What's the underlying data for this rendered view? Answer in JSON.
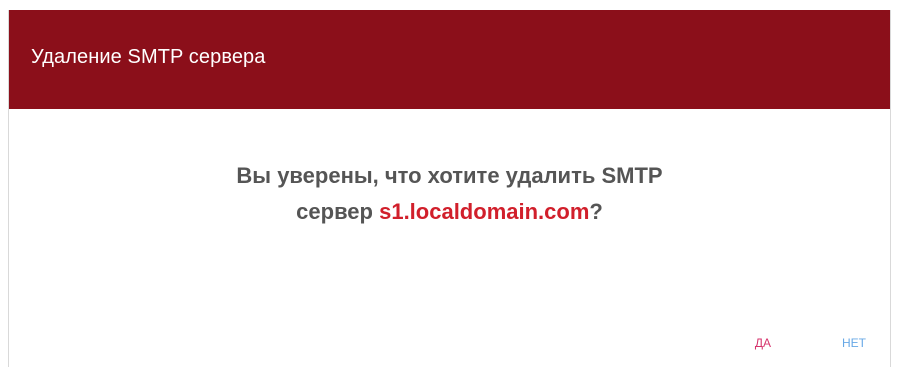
{
  "dialog": {
    "title": "Удаление SMTP сервера",
    "message_line1": "Вы уверены, что хотите удалить SMTP",
    "message_line2_prefix": "сервер ",
    "server_name": "s1.localdomain.com",
    "message_suffix": "?",
    "yes_label": "ДА",
    "no_label": "НЕТ"
  },
  "colors": {
    "header_bg": "#8b0f1a",
    "server_name": "#d11f2b",
    "yes_button": "#d6336c",
    "no_button": "#67a8e6"
  }
}
